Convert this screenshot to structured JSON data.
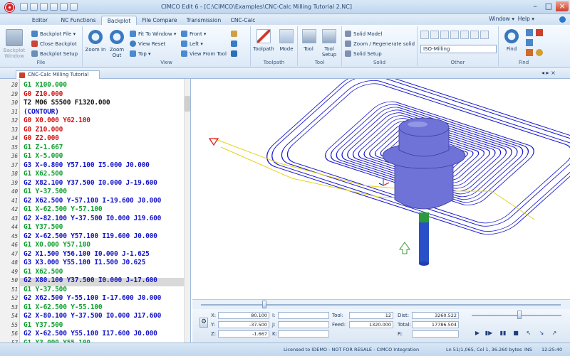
{
  "window": {
    "title": "CIMCO Edit 6 - [C:\\CIMCO\\Examples\\CNC-Calc Milling Tutorial 2.NC]"
  },
  "ribbon_tabs": [
    "Editor",
    "NC Functions",
    "Backplot",
    "File Compare",
    "Transmission",
    "CNC-Calc"
  ],
  "help": {
    "window": "Window ▾",
    "help": "Help ▾"
  },
  "file_group": {
    "label": "File",
    "backplot_window": "Backplot Window",
    "backplot_file": "Backplot File ▾",
    "close_backplot": "Close Backplot",
    "backplot_setup": "Backplot Setup"
  },
  "view_group": {
    "label": "View",
    "zoom_in": "Zoom In",
    "zoom_out": "Zoom Out",
    "fit_to_window": "Fit To Window ▾",
    "view_reset": "View Reset",
    "top": "Top ▾",
    "front": "Front ▾",
    "left": "Left ▾",
    "view_from_tool": "View From Tool"
  },
  "toolpath_group": {
    "label": "Toolpath",
    "toolpath": "Toolpath",
    "mode": "Mode"
  },
  "tool_group": {
    "label": "Tool",
    "tool": "Tool",
    "tool_setup": "Tool Setup"
  },
  "solid_group": {
    "label": "Solid",
    "solid_model": "Solid Model",
    "zoom_regenerate": "Zoom / Regenerate solid",
    "solid_setup": "Solid Setup"
  },
  "other_group": {
    "label": "Other",
    "iso_select": "ISO-Milling"
  },
  "find_group": {
    "label": "Find",
    "find": "Find"
  },
  "document": {
    "tab_label": "CNC-Calc Milling Tutorial 2.NC *"
  },
  "code_lines": [
    {
      "n": "28",
      "t": "G1 X100.000",
      "c": "g"
    },
    {
      "n": "29",
      "t": "G0 Z10.000",
      "c": "r"
    },
    {
      "n": "30",
      "t": "T2 M06 S5500 F1320.000",
      "c": "k"
    },
    {
      "n": "31",
      "t": "(CONTOUR)",
      "c": "b"
    },
    {
      "n": "32",
      "t": "G0 X0.000 Y62.100",
      "c": "r"
    },
    {
      "n": "33",
      "t": "G0 Z10.000",
      "c": "r"
    },
    {
      "n": "34",
      "t": "G0 Z2.000",
      "c": "r"
    },
    {
      "n": "35",
      "t": "G1 Z-1.667",
      "c": "g"
    },
    {
      "n": "36",
      "t": "G1 X-5.000",
      "c": "g"
    },
    {
      "n": "37",
      "t": "G3 X-0.800 Y57.100 I5.000 J0.000",
      "c": "b"
    },
    {
      "n": "38",
      "t": "G1 X62.500",
      "c": "g"
    },
    {
      "n": "39",
      "t": "G2 X82.100 Y37.500 I0.000 J-19.600",
      "c": "b"
    },
    {
      "n": "40",
      "t": "G1 Y-37.500",
      "c": "g"
    },
    {
      "n": "41",
      "t": "G2 X62.500 Y-57.100 I-19.600 J0.000",
      "c": "b"
    },
    {
      "n": "42",
      "t": "G1 X-62.500 Y-57.100",
      "c": "g"
    },
    {
      "n": "43",
      "t": "G2 X-82.100 Y-37.500 I0.000 J19.600",
      "c": "b"
    },
    {
      "n": "44",
      "t": "G1 Y37.500",
      "c": "g"
    },
    {
      "n": "45",
      "t": "G2 X-62.500 Y57.100 I19.600 J0.000",
      "c": "b"
    },
    {
      "n": "46",
      "t": "G1 X0.000 Y57.100",
      "c": "g"
    },
    {
      "n": "47",
      "t": "G2 X1.500 Y56.100 I0.000 J-1.625",
      "c": "b"
    },
    {
      "n": "48",
      "t": "G3 X3.000 Y55.100 I1.500 J0.625",
      "c": "b"
    },
    {
      "n": "49",
      "t": "G1 X62.500",
      "c": "g"
    },
    {
      "n": "50",
      "t": "G2 X80.100 Y37.500 I0.000 J-17.600",
      "c": "b"
    },
    {
      "n": "51",
      "t": "G1 Y-37.500",
      "c": "g"
    },
    {
      "n": "52",
      "t": "G2 X62.500 Y-55.100 I-17.600 J0.000",
      "c": "b"
    },
    {
      "n": "53",
      "t": "G1 X-62.500 Y-55.100",
      "c": "g"
    },
    {
      "n": "54",
      "t": "G2 X-80.100 Y-37.500 I0.000 J17.600",
      "c": "b"
    },
    {
      "n": "55",
      "t": "G1 Y37.500",
      "c": "g"
    },
    {
      "n": "56",
      "t": "G2 X-62.500 Y55.100 I17.600 J0.000",
      "c": "b"
    },
    {
      "n": "57",
      "t": "G1 X3.000 Y55.100",
      "c": "g"
    }
  ],
  "colors": {
    "g": "#0f9f2f",
    "r": "#d21414",
    "b": "#1414c8",
    "k": "#111111",
    "toolpath": "#1a1ad0",
    "rapid": "#e6d21a",
    "tool_body": "#6f73d8",
    "tool_shank": "#2a50c8",
    "marker": "#e01a1a"
  },
  "coords": {
    "x_label": "X:",
    "x_value": "80.100",
    "y_label": "Y:",
    "y_value": "-37.500",
    "z_label": "Z:",
    "z_value": "-1.667",
    "i_label": "I:",
    "j_label": "J:",
    "k_label": "K:",
    "tool_label": "Tool:",
    "tool_value": "12",
    "feed_label": "Feed:",
    "feed_value": "1320.000",
    "dist_label": "Dist:",
    "dist_value": "3260.522",
    "total_label": "Total:",
    "total_value": "17786.504",
    "r_label": "R:"
  },
  "status": {
    "license": "Licensed to IDEMO - NOT FOR RESALE - CIMCO Integration",
    "position": "Ln 51/1,065, Col 1, 36.260 bytes",
    "mode": "INS",
    "time": "12:25:40"
  }
}
